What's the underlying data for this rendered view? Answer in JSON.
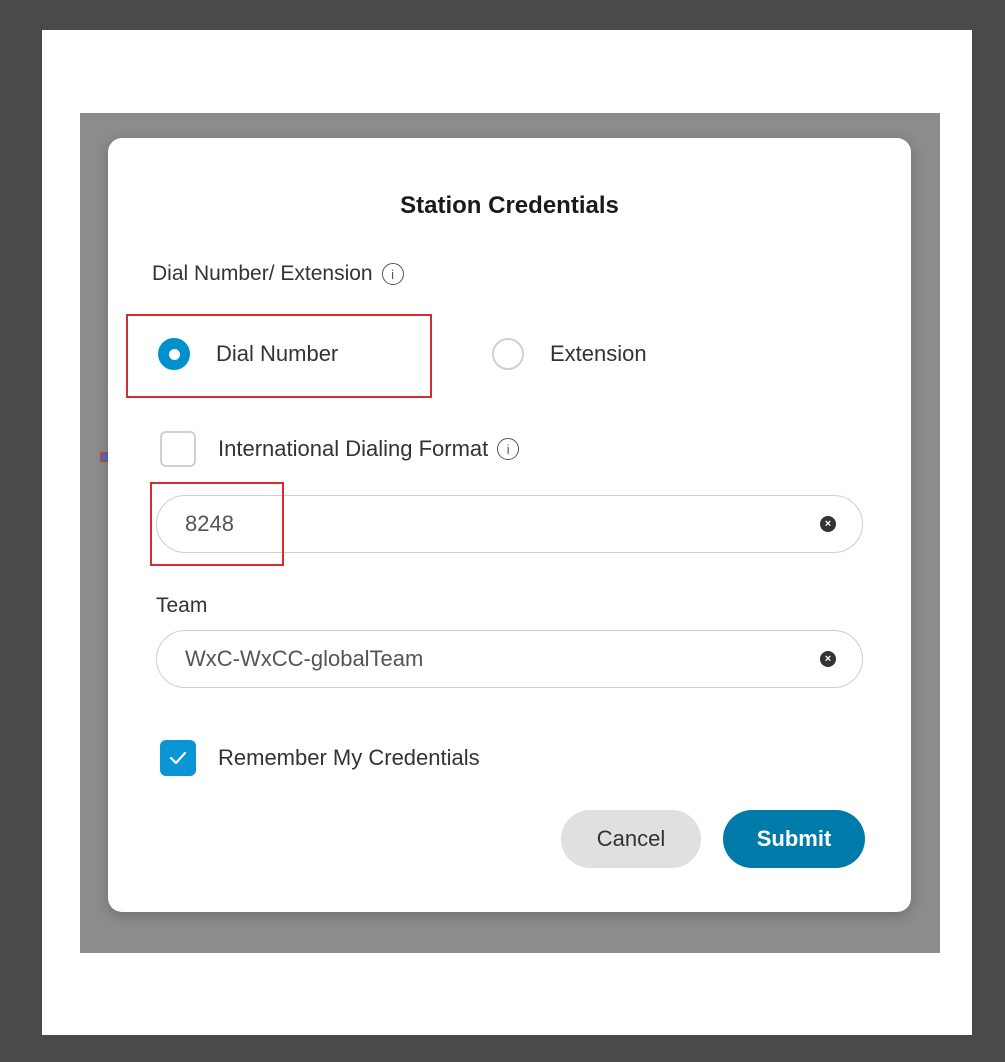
{
  "dialog": {
    "title": "Station Credentials",
    "dial_section_label": "Dial Number/ Extension",
    "radio_options": [
      {
        "label": "Dial Number",
        "selected": true
      },
      {
        "label": "Extension",
        "selected": false
      }
    ],
    "international_format": {
      "label": "International Dialing Format",
      "checked": false
    },
    "dial_number_input": {
      "value": "8248"
    },
    "team": {
      "label": "Team",
      "value": "WxC-WxCC-globalTeam"
    },
    "remember": {
      "label": "Remember My Credentials",
      "checked": true
    },
    "buttons": {
      "cancel": "Cancel",
      "submit": "Submit"
    }
  },
  "icons": {
    "info": "i",
    "clear": "×",
    "check": "check-icon",
    "arrow": "right-arrow-icon"
  },
  "colors": {
    "accent": "#0090cc",
    "submit": "#007aa8",
    "highlight": "#d32f2f",
    "arrow": "#4a72c4"
  }
}
